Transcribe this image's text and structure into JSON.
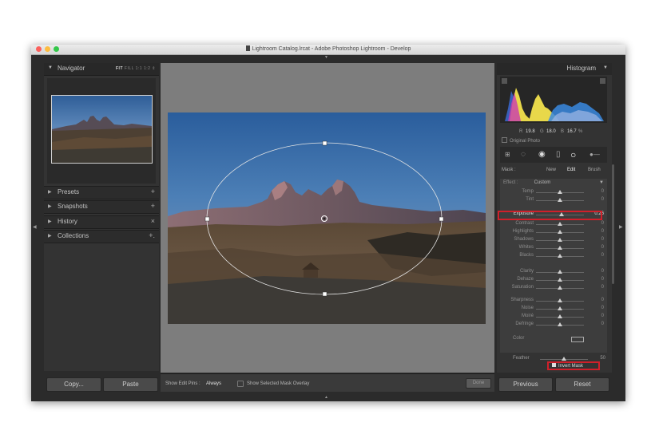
{
  "window": {
    "title": "Lightroom Catalog.lrcat - Adobe Photoshop Lightroom - Develop"
  },
  "left_panel": {
    "navigator": {
      "title": "Navigator",
      "zoom_fit": "FIT",
      "zoom_fill": "FILL",
      "zoom_1": "1:1",
      "zoom_3": "1:2"
    },
    "sections": [
      {
        "label": "Presets",
        "action": "+"
      },
      {
        "label": "Snapshots",
        "action": "+"
      },
      {
        "label": "History",
        "action": "×"
      },
      {
        "label": "Collections",
        "action": "+."
      }
    ],
    "copy_label": "Copy...",
    "paste_label": "Paste"
  },
  "toolbar": {
    "show_edit_pins_label": "Show Edit Pins :",
    "show_edit_pins_value": "Always",
    "mask_overlay_label": "Show Selected Mask Overlay",
    "done_label": "Done"
  },
  "right_panel": {
    "histogram_title": "Histogram",
    "readout": {
      "r_label": "R",
      "r_value": "19.8",
      "g_label": "G",
      "g_value": "18.0",
      "b_label": "B",
      "b_value": "16.7",
      "pct": "%"
    },
    "original_photo_label": "Original Photo",
    "mask": {
      "label": "Mask :",
      "new": "New",
      "edit": "Edit",
      "brush": "Brush"
    },
    "effect": {
      "label": "Effect :",
      "value": "Custom"
    },
    "sliders": [
      {
        "label": "Temp",
        "value": "0",
        "pos": 0.5
      },
      {
        "label": "Tint",
        "value": "0",
        "pos": 0.5
      },
      {
        "label": "Exposure",
        "value": "0.26",
        "pos": 0.53,
        "highlight": true
      },
      {
        "label": "Contrast",
        "value": "0",
        "pos": 0.5
      },
      {
        "label": "Highlights",
        "value": "0",
        "pos": 0.5
      },
      {
        "label": "Shadows",
        "value": "0",
        "pos": 0.5
      },
      {
        "label": "Whites",
        "value": "0",
        "pos": 0.5
      },
      {
        "label": "Blacks",
        "value": "0",
        "pos": 0.5
      },
      {
        "label": "Clarity",
        "value": "0",
        "pos": 0.5
      },
      {
        "label": "Dehaze",
        "value": "0",
        "pos": 0.5
      },
      {
        "label": "Saturation",
        "value": "0",
        "pos": 0.5
      },
      {
        "label": "Sharpness",
        "value": "0",
        "pos": 0.5
      },
      {
        "label": "Noise",
        "value": "0",
        "pos": 0.5
      },
      {
        "label": "Moiré",
        "value": "0",
        "pos": 0.5
      },
      {
        "label": "Defringe",
        "value": "0",
        "pos": 0.5
      }
    ],
    "color_label": "Color",
    "feather_label": "Feather",
    "feather_value": "50",
    "feather_pos": 0.5,
    "invert_mask_label": "Invert Mask",
    "previous_label": "Previous",
    "reset_label": "Reset"
  }
}
